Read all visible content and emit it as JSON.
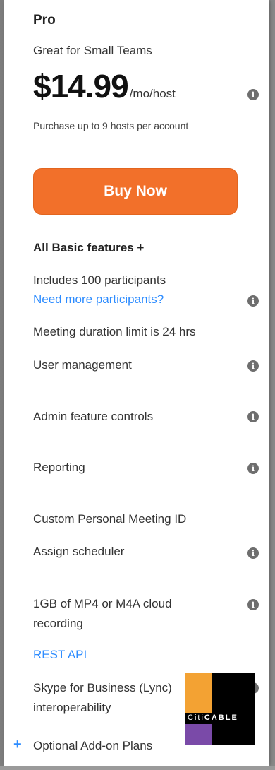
{
  "plan": {
    "name": "Pro",
    "subtitle": "Great for Small Teams",
    "price": "$14.99",
    "price_unit": "/mo/host",
    "hosts_note": "Purchase up to 9 hosts per account",
    "buy_label": "Buy Now"
  },
  "features": {
    "basic": "All Basic features +",
    "participants": "Includes 100 participants",
    "more_participants_link": "Need more participants?",
    "duration": "Meeting duration limit is 24 hrs",
    "user_mgmt": "User management",
    "admin_controls": "Admin feature controls",
    "reporting": "Reporting",
    "custom_pmi": "Custom Personal Meeting ID",
    "scheduler": "Assign scheduler",
    "cloud_recording": "1GB of MP4 or M4A cloud recording",
    "rest_api": "REST API",
    "skype": "Skype for Business (Lync) interoperability",
    "addons": "Optional Add-on Plans"
  },
  "info_icon_glyph": "i",
  "plus_glyph": "+",
  "watermark": {
    "part1": "Citi",
    "part2": "CABLE"
  },
  "colors": {
    "accent_button": "#f2702a",
    "link": "#2d8cff",
    "info_icon": "#6e6e6e"
  }
}
